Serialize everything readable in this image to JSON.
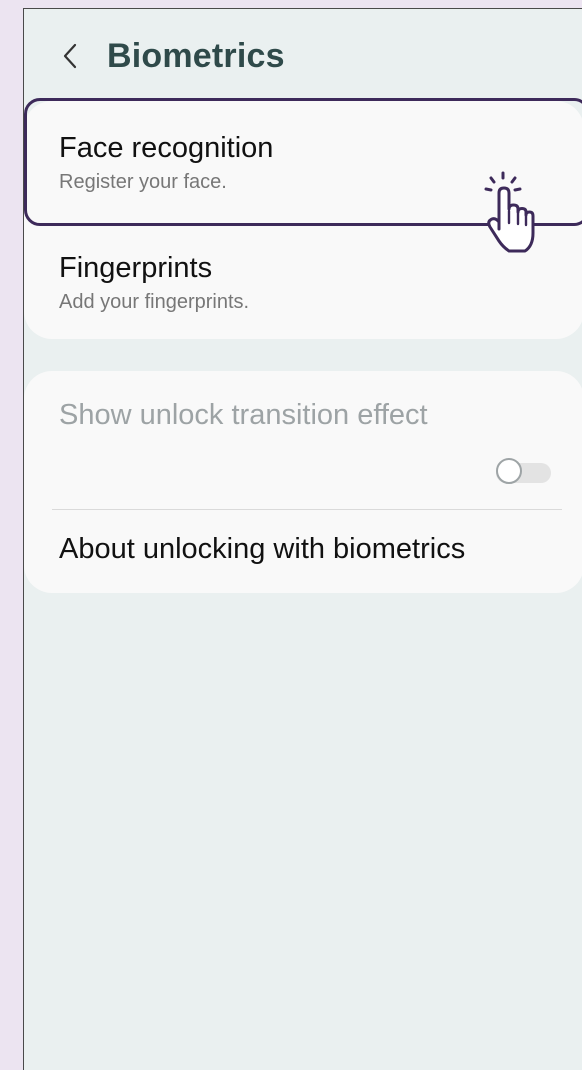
{
  "header": {
    "title": "Biometrics",
    "back_icon": "chevron-left-icon"
  },
  "biometrics": {
    "items": [
      {
        "label": "Face recognition",
        "description": "Register your face."
      },
      {
        "label": "Fingerprints",
        "description": "Add your fingerprints."
      }
    ]
  },
  "settings": {
    "unlock_transition_label": "Show unlock transition effect",
    "unlock_transition_enabled": false,
    "about_label": "About unlocking with biometrics"
  },
  "colors": {
    "accent_focus": "#3D2A5A",
    "title": "#2F4A4A",
    "background": "#EAF0F0"
  }
}
